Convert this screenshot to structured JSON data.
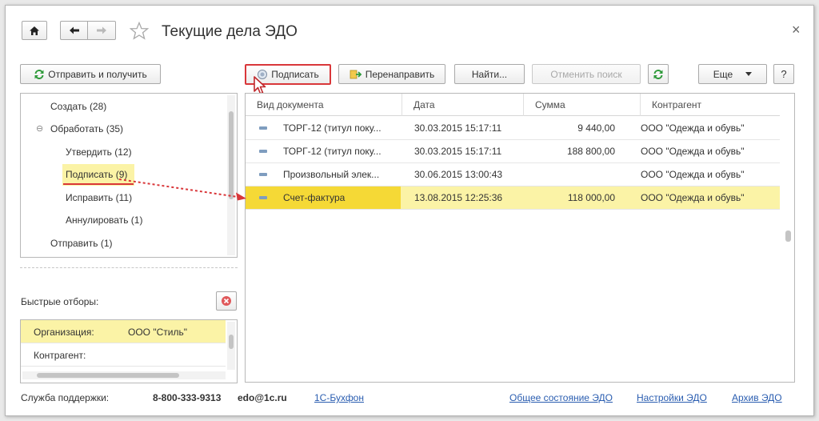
{
  "window": {
    "title": "Текущие дела ЭДО",
    "close_glyph": "×"
  },
  "nav": {
    "home_icon": "home-icon",
    "back_icon": "arrow-left-icon",
    "forward_icon": "arrow-right-icon",
    "favorite_icon": "star-icon"
  },
  "toolbar": {
    "send_receive_label": "Отправить и получить",
    "sign_label": "Подписать",
    "redirect_label": "Перенаправить",
    "find_label": "Найти...",
    "cancel_search_label": "Отменить поиск",
    "more_label": "Еще",
    "help_label": "?"
  },
  "tree": {
    "items": [
      {
        "label": "Создать (28)"
      },
      {
        "label": "Обработать (35)",
        "expanded_glyph": "⊖"
      },
      {
        "label": "Утвердить (12)"
      },
      {
        "label": "Подписать (9)"
      },
      {
        "label": "Исправить (11)"
      },
      {
        "label": "Аннулировать (1)"
      },
      {
        "label": "Отправить (1)"
      }
    ]
  },
  "quick_filters": {
    "label": "Быстрые отборы:",
    "rows": [
      {
        "field": "Организация:",
        "value": "ООО \"Стиль\""
      },
      {
        "field": "Контрагент:",
        "value": ""
      }
    ]
  },
  "grid": {
    "columns": [
      "Вид документа",
      "Дата",
      "Сумма",
      "Контрагент"
    ],
    "rows": [
      {
        "doc": "ТОРГ-12 (титул поку...",
        "date": "30.03.2015 15:17:11",
        "sum": "9 440,00",
        "partner": "ООО \"Одежда и обувь\"",
        "selected": false
      },
      {
        "doc": "ТОРГ-12 (титул поку...",
        "date": "30.03.2015 15:17:11",
        "sum": "188 800,00",
        "partner": "ООО \"Одежда и обувь\"",
        "selected": false
      },
      {
        "doc": "Произвольный элек...",
        "date": "30.06.2015 13:00:43",
        "sum": "",
        "partner": "ООО \"Одежда и обувь\"",
        "selected": false
      },
      {
        "doc": "Счет-фактура",
        "date": "13.08.2015 12:25:36",
        "sum": "118 000,00",
        "partner": "ООО \"Одежда и обувь\"",
        "selected": true
      }
    ]
  },
  "footer": {
    "support_label": "Служба поддержки:",
    "phone": "8-800-333-9313",
    "email": "edo@1c.ru",
    "buhfon_link": "1С-Бухфон",
    "status_link": "Общее состояние ЭДО",
    "settings_link": "Настройки ЭДО",
    "archive_link": "Архив ЭДО"
  },
  "colors": {
    "highlight_red": "#d9373a",
    "selected_row": "#fbf3a6",
    "selected_cell": "#f5d936",
    "link": "#2a5db0"
  }
}
